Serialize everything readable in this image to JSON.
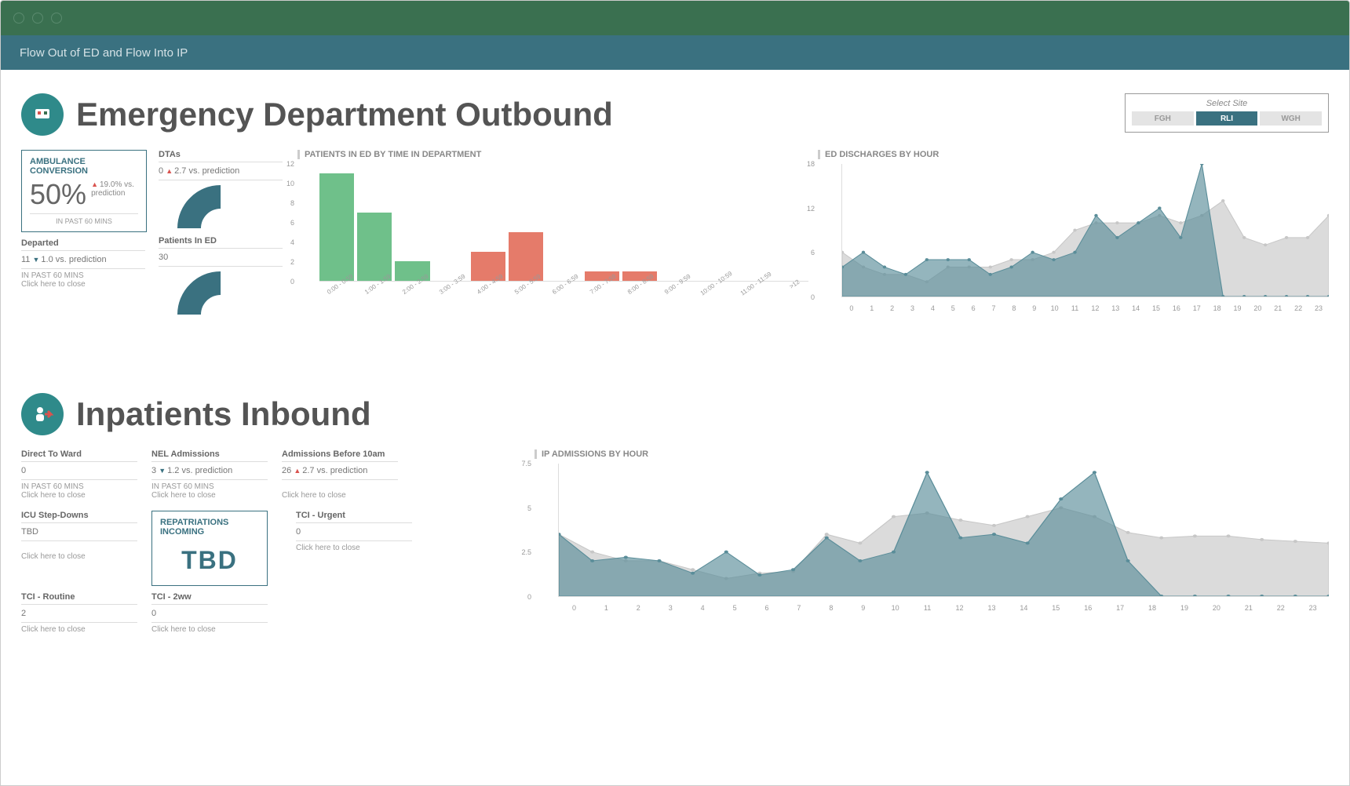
{
  "header": {
    "title": "Flow Out of ED and Flow Into IP"
  },
  "section1": {
    "title": "Emergency Department Outbound",
    "site": {
      "label": "Select Site",
      "options": [
        "FGH",
        "RLI",
        "WGH"
      ],
      "active": "RLI"
    }
  },
  "ambulance": {
    "title": "AMBULANCE CONVERSION",
    "value": "50%",
    "delta": "19.0% vs. prediction",
    "foot": "IN PAST 60 MINS"
  },
  "departed": {
    "title": "Departed",
    "value": "11",
    "delta": "1.0 vs. prediction",
    "note1": "IN PAST 60 MINS",
    "note2": "Click here to close"
  },
  "dtas": {
    "title": "DTAs",
    "value": "0",
    "delta": "2.7 vs. prediction"
  },
  "patientsInEd": {
    "title": "Patients In ED",
    "value": "30"
  },
  "chart_ed_time": {
    "title": "PATIENTS IN ED BY TIME IN DEPARTMENT",
    "type": "bar",
    "categories": [
      "0:00 - 0:59",
      "1:00 - 1:59",
      "2:00 - 2:59",
      "3:00 - 3:59",
      "4:00 - 4:59",
      "5:00 - 5:59",
      "6:00 - 6:59",
      "7:00 - 7:59",
      "8:00 - 8:59",
      "9:00 - 9:59",
      "10:00 - 10:59",
      "11:00 - 11:59",
      ">12"
    ],
    "values": [
      11,
      7,
      2,
      0,
      3,
      5,
      0,
      1,
      1,
      0,
      0,
      0,
      0
    ],
    "colors": [
      "#6fc08a",
      "#6fc08a",
      "#6fc08a",
      "#6fc08a",
      "#e57b6a",
      "#e57b6a",
      "#e57b6a",
      "#e57b6a",
      "#e57b6a",
      "#e57b6a",
      "#e57b6a",
      "#e57b6a",
      "#e57b6a"
    ],
    "ylim": [
      0,
      12
    ],
    "yticks": [
      0,
      2,
      4,
      6,
      8,
      10,
      12
    ]
  },
  "chart_ed_disch": {
    "title": "ED DISCHARGES BY HOUR",
    "type": "area-2series",
    "x": [
      0,
      1,
      2,
      3,
      4,
      5,
      6,
      7,
      8,
      9,
      10,
      11,
      12,
      13,
      14,
      15,
      16,
      17,
      18,
      19,
      20,
      21,
      22,
      23
    ],
    "series": [
      {
        "name": "grey",
        "values": [
          6,
          4,
          3,
          3,
          2,
          4,
          4,
          4,
          5,
          5,
          6,
          9,
          10,
          10,
          10,
          11,
          10,
          11,
          13,
          8,
          7,
          8,
          8,
          11
        ],
        "color": "#c7c7c7"
      },
      {
        "name": "teal",
        "values": [
          4,
          6,
          4,
          3,
          5,
          5,
          5,
          3,
          4,
          6,
          5,
          6,
          11,
          8,
          10,
          12,
          8,
          18,
          0,
          0,
          0,
          0,
          0,
          0
        ],
        "color": "#5a8d99"
      }
    ],
    "ylim": [
      0,
      18
    ],
    "yticks": [
      0,
      6,
      12,
      18
    ]
  },
  "section2": {
    "title": "Inpatients Inbound"
  },
  "directToWard": {
    "title": "Direct To Ward",
    "value": "0",
    "note1": "IN PAST 60 MINS",
    "note2": "Click here to close"
  },
  "nelAdmissions": {
    "title": "NEL Admissions",
    "value": "3",
    "delta": "1.2 vs. prediction",
    "note1": "IN PAST 60 MINS",
    "note2": "Click here to close"
  },
  "admBefore10": {
    "title": "Admissions Before 10am",
    "value": "26",
    "delta": "2.7 vs. prediction",
    "note2": "Click here to close"
  },
  "icuStep": {
    "title": "ICU Step-Downs",
    "value": "TBD",
    "note2": "Click here to close"
  },
  "repatriations": {
    "title": "REPATRIATIONS INCOMING",
    "value": "TBD"
  },
  "tciUrgent": {
    "title": "TCI - Urgent",
    "value": "0",
    "note2": "Click here to close"
  },
  "tciRoutine": {
    "title": "TCI - Routine",
    "value": "2",
    "note2": "Click here to close"
  },
  "tci2ww": {
    "title": "TCI - 2ww",
    "value": "0",
    "note2": "Click here to close"
  },
  "chart_ip_adm": {
    "title": "IP ADMISSIONS BY HOUR",
    "type": "area-2series",
    "x": [
      0,
      1,
      2,
      3,
      4,
      5,
      6,
      7,
      8,
      9,
      10,
      11,
      12,
      13,
      14,
      15,
      16,
      17,
      18,
      19,
      20,
      21,
      22,
      23
    ],
    "series": [
      {
        "name": "grey",
        "values": [
          3.5,
          2.5,
          2,
          2,
          1.5,
          1,
          1.3,
          1.4,
          3.5,
          3,
          4.5,
          4.7,
          4.3,
          4,
          4.5,
          5,
          4.5,
          3.6,
          3.3,
          3.4,
          3.4,
          3.2,
          3.1,
          3
        ],
        "color": "#c7c7c7"
      },
      {
        "name": "teal",
        "values": [
          3.5,
          2,
          2.2,
          2,
          1.3,
          2.5,
          1.2,
          1.5,
          3.3,
          2,
          2.5,
          7,
          3.3,
          3.5,
          3,
          5.5,
          7,
          2,
          0,
          0,
          0,
          0,
          0,
          0
        ],
        "color": "#5a8d99"
      }
    ],
    "ylim": [
      0,
      7.5
    ],
    "yticks": [
      0,
      2.5,
      5,
      7.5
    ]
  }
}
